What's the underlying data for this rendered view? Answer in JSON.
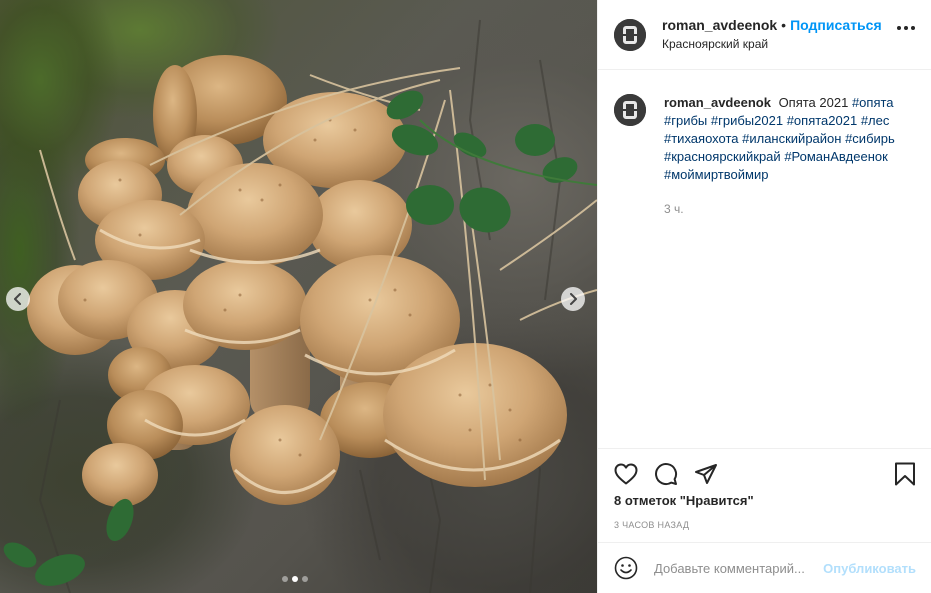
{
  "post": {
    "username": "roman_avdeenok",
    "separator": "•",
    "follow_label": "Подписаться",
    "location": "Красноярский край",
    "more_icon": "more-horizontal-icon"
  },
  "caption": {
    "username": "roman_avdeenok",
    "text": "Опята 2021",
    "hashtags": [
      "#опята",
      "#грибы",
      "#грибы2021",
      "#опята2021",
      "#лес",
      "#тихаяохота",
      "#иланскийрайон",
      "#сибирь",
      "#красноярскийкрай",
      "#РоманАвдеенок",
      "#моймиртвоймир"
    ],
    "time": "3 ч."
  },
  "actions": {
    "icons": [
      "heart-icon",
      "comment-icon",
      "share-icon",
      "bookmark-icon"
    ],
    "likes": "8 отметок \"Нравится\"",
    "date": "3 ЧАСОВ НАЗАД"
  },
  "comment": {
    "placeholder": "Добавьте комментарий...",
    "publish_label": "Опубликовать"
  },
  "carousel": {
    "slide_count": 3,
    "active_slide": 2
  },
  "colors": {
    "accent": "#0095f6",
    "hashtag": "#00376b",
    "muted": "#8e8e8e",
    "publish_disabled": "#b2dffc"
  }
}
